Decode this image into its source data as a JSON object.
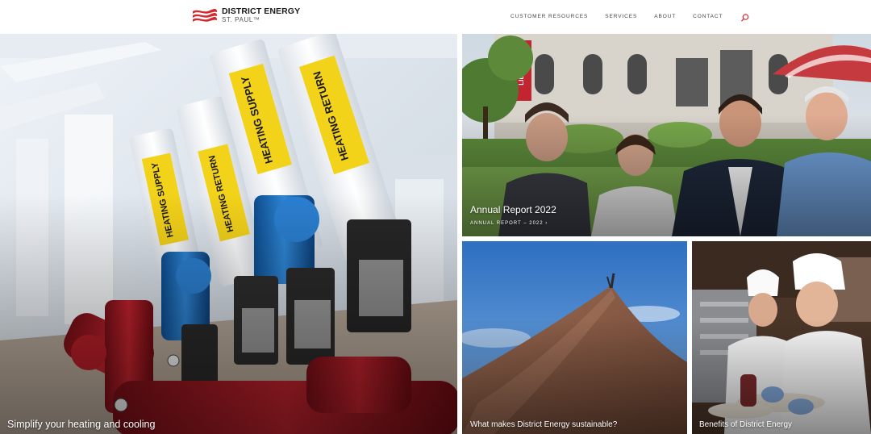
{
  "header": {
    "logo": {
      "line1": "DISTRICT ENERGY",
      "line2": "ST. PAUL™",
      "brand_color": "#d7282f"
    },
    "nav": {
      "items": [
        {
          "label": "CUSTOMER RESOURCES"
        },
        {
          "label": "SERVICES"
        },
        {
          "label": "ABOUT"
        },
        {
          "label": "CONTACT"
        }
      ],
      "search_icon": "search-icon",
      "search_color": "#d7282f"
    }
  },
  "tiles": {
    "heating": {
      "title": "Simplify your heating and cooling"
    },
    "annual": {
      "title": "Annual Report 2022",
      "subtitle": "ANNUAL REPORT – 2022 ›"
    },
    "sustainable": {
      "title": "What makes District Energy sustainable?"
    },
    "benefits": {
      "title": "Benefits of District Energy"
    }
  },
  "photo_labels": {
    "heating_supply": "HEATING SUPPLY",
    "heating_return": "HEATING RETURN",
    "library": "LIBRARY"
  }
}
